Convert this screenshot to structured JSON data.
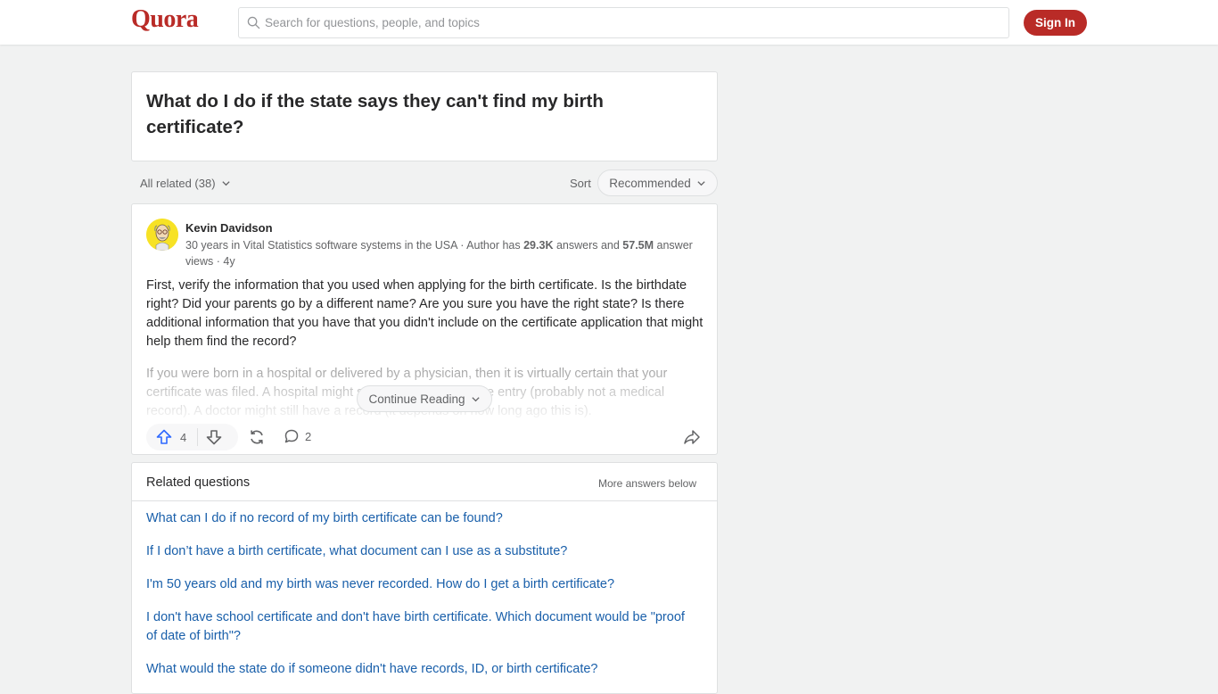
{
  "header": {
    "logo": "Quora",
    "search_placeholder": "Search for questions, people, and topics",
    "signin_label": "Sign In",
    "brand_color": "#b92b27"
  },
  "question": {
    "title": "What do I do if the state says they can't find my birth certificate?"
  },
  "filters": {
    "all_related": "All related (38)",
    "sort_label": "Sort",
    "sort_value": "Recommended"
  },
  "answer": {
    "author": "Kevin Davidson",
    "credential_prefix": "30 years in Vital Statistics software systems in the USA · Author has ",
    "answers_count": "29.3K",
    "credential_mid": " answers and ",
    "views_count": "57.5M",
    "credential_suffix": " answer views · 4y",
    "body": "First, verify the information that you used when applying for the birth certificate. Is the birthdate right? Did your parents go by a different name? Are you sure you have the right state? Is there additional information that you have that you didn't include on the certificate application that might help them find the record?",
    "faded_body": "If you were born in a hospital or delivered by a physician, then it is virtually certain that your certificate was filed. A hospital might still have a record of the entry (probably not a medical record). A doctor might still have a record (it depends on how long ago this is).",
    "continue_label": "Continue Reading",
    "upvotes": "4",
    "comments": "2"
  },
  "related": {
    "title": "Related questions",
    "more_label": "More answers below",
    "items": [
      "What can I do if no record of my birth certificate can be found?",
      "If I don’t have a birth certificate, what document can I use as a substitute?",
      "I'm 50 years old and my birth was never recorded. How do I get a birth certificate?",
      "I don't have school certificate and don't have birth certificate. Which document would be \"proof of date of birth\"?",
      "What would the state do if someone didn't have records, ID, or birth certificate?"
    ]
  }
}
